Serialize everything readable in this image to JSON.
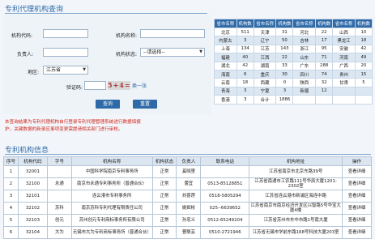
{
  "query": {
    "title": "专利代理机构查询",
    "fields": {
      "code_label": "机构代码:",
      "name_label": "机构名称:",
      "leader_label": "负责人:",
      "status_label": "机构状态:",
      "status_value": "--请选择--",
      "region_label": "地区:",
      "region_value": "江苏省",
      "captcha_label": "验证码:",
      "captcha_image_text": "5+4=",
      "refresh_label": "换一张"
    },
    "buttons": {
      "search": "查询",
      "reset": "重置"
    },
    "notes": [
      "本查询结果为专利代理机构自行登录专利代理管理系统进行数据填报",
      "护，关键数据的新录应事项变更需提请相关部门进行审核。"
    ]
  },
  "stats": {
    "headers": [
      "省市名称",
      "机构数",
      "省市名称",
      "机构数",
      "省市名称",
      "机构数",
      "省市名称",
      "机构数"
    ],
    "rows": [
      [
        "北京",
        "511",
        "天津",
        "31",
        "河北",
        "22",
        "山西",
        "10"
      ],
      [
        "内蒙古",
        "3",
        "辽宁",
        "50",
        "吉林",
        "17",
        "黑龙江",
        "18"
      ],
      [
        "上海",
        "134",
        "江苏",
        "143",
        "浙江",
        "95",
        "安徽",
        "42"
      ],
      [
        "福建",
        "40",
        "江西",
        "22",
        "山东",
        "71",
        "河南",
        "49"
      ],
      [
        "湖北",
        "42",
        "湖南",
        "33",
        "广东",
        "288",
        "广西",
        "20"
      ],
      [
        "海南",
        "6",
        "重庆",
        "30",
        "四川",
        "74",
        "贵州",
        "15"
      ],
      [
        "云南",
        "18",
        "西藏",
        "0",
        "陕西",
        "32",
        "甘肃",
        "5"
      ],
      [
        "青海",
        "3",
        "宁夏",
        "3",
        "新疆",
        "12",
        "",
        ""
      ],
      [
        "香港",
        "3",
        "合计",
        "1886",
        "",
        "",
        "",
        ""
      ]
    ]
  },
  "info": {
    "title": "专利机构信息",
    "headers": [
      "序号",
      "机构代码",
      "字号",
      "机构名称",
      "机构状态",
      "负责人",
      "联系电话",
      "机构地址",
      "操作"
    ],
    "rows": [
      [
        "1",
        "32001",
        "",
        "中国科学院南京专利事务所",
        "正常",
        "奚晓里",
        "",
        "江苏省南京市北京东路39号",
        "查看详细"
      ],
      [
        "2",
        "32100",
        "永通",
        "南京市永通专利事务所（普通合伙）",
        "正常",
        "蕾宜",
        "0513-85128851",
        "江苏省南通市工农路111号华辰大厦1201-2302室",
        "查看详细"
      ],
      [
        "3",
        "32101",
        "",
        "连云港市专利事务所",
        "正常",
        "刘喜莲",
        "0518-5805294",
        "江苏省连云港市新浦区海连中路",
        "查看详细"
      ],
      [
        "4",
        "32102",
        "苏科",
        "南京苏科专利代理有限责任公司",
        "正常",
        "姚姬彬",
        "025--6639652",
        "江苏省南京市南京经济开发区兴智路5号华宝大厦4楼",
        "查看详细"
      ],
      [
        "5",
        "32103",
        "创元",
        "苏州创元专利商标事务所有限公司",
        "正常",
        "孙忠义",
        "0512-65249204",
        "江苏省苏州市东中市路1号南大厦",
        "查看详细"
      ],
      [
        "6",
        "32104",
        "大为",
        "无锡市大为专利商标事务所（普通合伙）",
        "正常",
        "曹联芸",
        "0510-2721946",
        "江苏省无锡市学前东路168号科技大厦203室",
        "查看详细"
      ]
    ]
  }
}
